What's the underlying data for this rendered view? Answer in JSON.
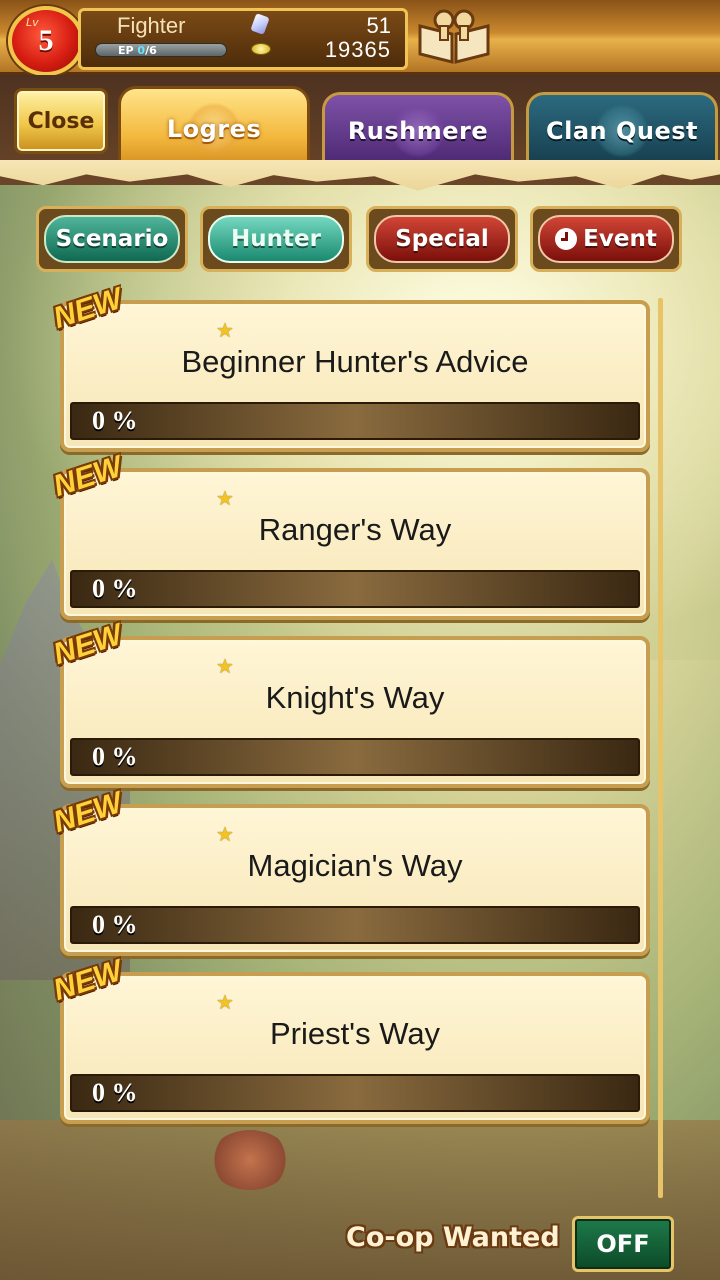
{
  "player": {
    "level_prefix": "Lv",
    "level": "5",
    "name": "Fighter",
    "ep_label": "EP",
    "ep_value": "0",
    "ep_max": "/6",
    "gems": "51",
    "gold": "19365"
  },
  "nav": {
    "close_label": "Close",
    "tabs": [
      {
        "label": "Logres",
        "active": true
      },
      {
        "label": "Rushmere",
        "active": false
      },
      {
        "label": "Clan Quest",
        "active": false
      }
    ]
  },
  "categories": [
    {
      "label": "Scenario",
      "color": "#0f6a52"
    },
    {
      "label": "Hunter",
      "color": "#1a8a70",
      "selected": true
    },
    {
      "label": "Special",
      "color": "#7b0f0a"
    },
    {
      "label": "Event",
      "color": "#7b0f0a",
      "icon": "clock-icon"
    }
  ],
  "quests": [
    {
      "badge": "NEW",
      "title": "Beginner Hunter's Advice",
      "progress": 0,
      "progress_text": "0 %",
      "stars": 1
    },
    {
      "badge": "NEW",
      "title": "Ranger's Way",
      "progress": 0,
      "progress_text": "0 %",
      "stars": 1
    },
    {
      "badge": "NEW",
      "title": "Knight's Way",
      "progress": 0,
      "progress_text": "0 %",
      "stars": 1
    },
    {
      "badge": "NEW",
      "title": "Magician's Way",
      "progress": 0,
      "progress_text": "0 %",
      "stars": 1
    },
    {
      "badge": "NEW",
      "title": "Priest's Way",
      "progress": 0,
      "progress_text": "0 %",
      "stars": 1
    }
  ],
  "coop": {
    "label": "Co-op Wanted",
    "toggle": "OFF"
  },
  "icons": {
    "gem": "gem-icon",
    "coin": "coin-icon",
    "book": "quest-book-icon",
    "star": "star-icon"
  }
}
